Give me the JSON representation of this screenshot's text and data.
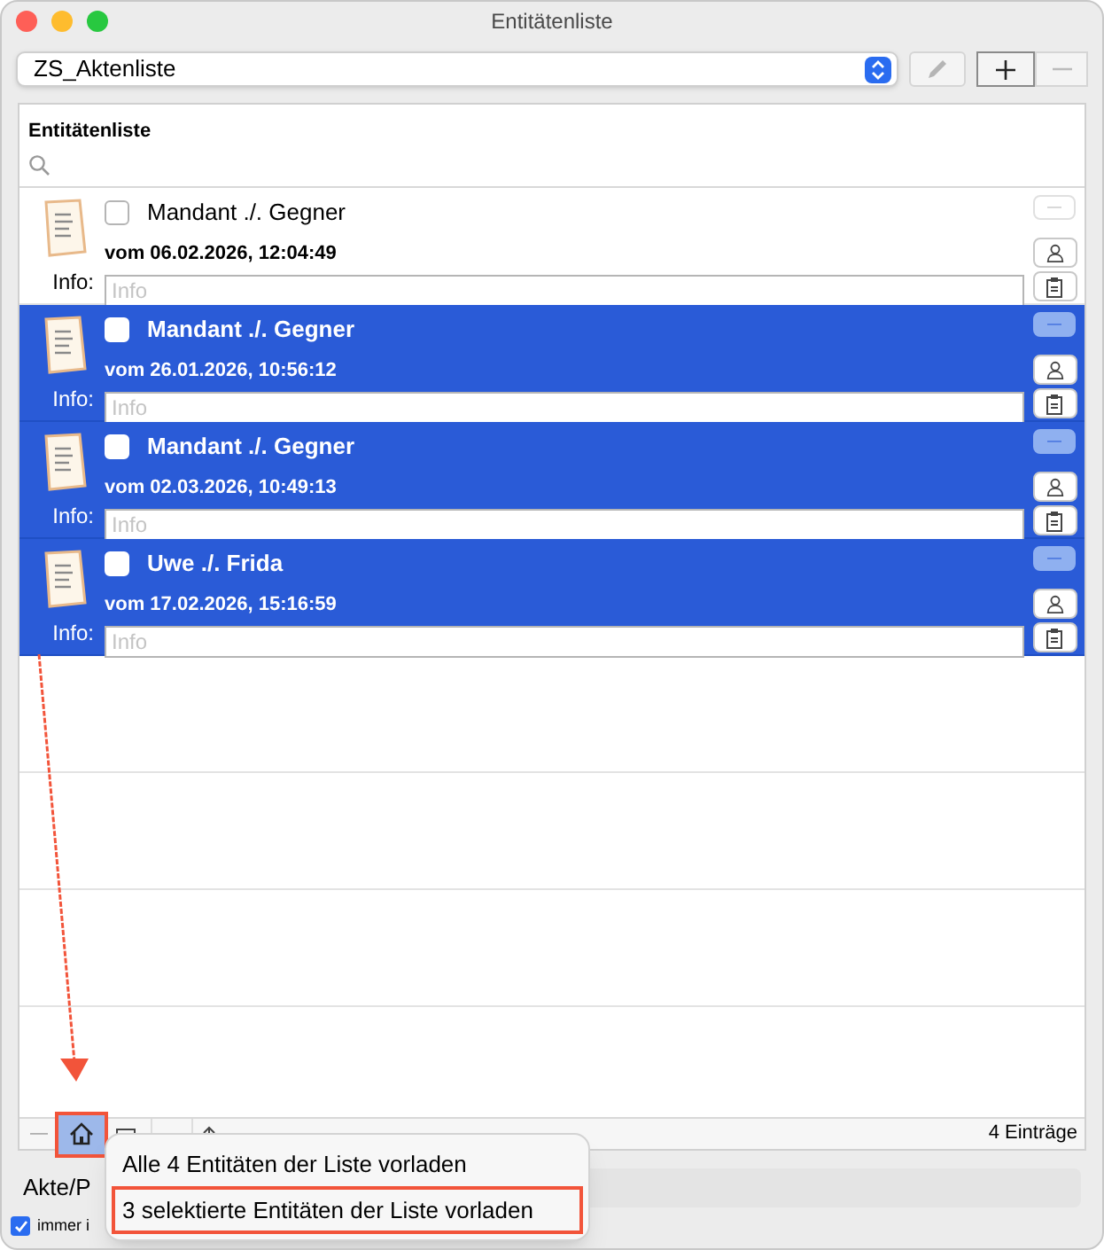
{
  "window": {
    "title": "Entitätenliste"
  },
  "list_selector": {
    "value": "ZS_Aktenliste"
  },
  "panel": {
    "header": "Entitätenliste"
  },
  "entries": [
    {
      "title": "Mandant ./. Gegner",
      "date": "vom 06.02.2026, 12:04:49",
      "info_label": "Info:",
      "info_placeholder": "Info",
      "selected": false,
      "checked": false
    },
    {
      "title": "Mandant ./. Gegner",
      "date": "vom 26.01.2026, 10:56:12",
      "info_label": "Info:",
      "info_placeholder": "Info",
      "selected": true,
      "checked": false
    },
    {
      "title": "Mandant ./. Gegner",
      "date": "vom 02.03.2026, 10:49:13",
      "info_label": "Info:",
      "info_placeholder": "Info",
      "selected": true,
      "checked": false
    },
    {
      "title": "Uwe ./. Frida",
      "date": "vom 17.02.2026, 15:16:59",
      "info_label": "Info:",
      "info_placeholder": "Info",
      "selected": true,
      "checked": false
    }
  ],
  "toolbar": {
    "minus": "—",
    "home_selected": true,
    "count": "4 Einträge"
  },
  "akte_label": "Akte/P",
  "always_checkbox": {
    "label": "immer i",
    "checked": true
  },
  "popup_menu": [
    {
      "label": "Alle 4 Entitäten der Liste vorladen",
      "highlighted": false
    },
    {
      "label": "3 selektierte Entitäten der Liste vorladen",
      "highlighted": true
    }
  ]
}
